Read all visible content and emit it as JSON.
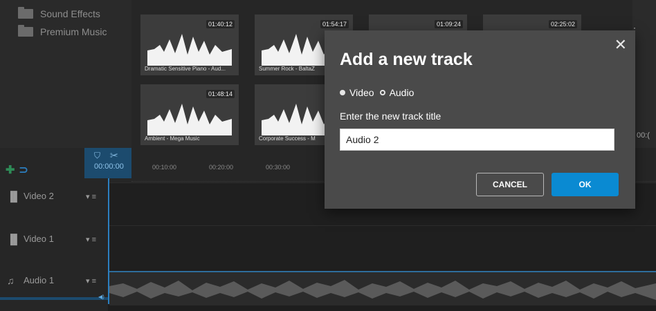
{
  "library": {
    "folders": [
      {
        "label": "Sound Effects"
      },
      {
        "label": "Premium Music"
      }
    ],
    "tiles": [
      {
        "duration": "01:40:12",
        "name": "Dramatic Sensitive Piano - Aud..."
      },
      {
        "duration": "01:54:17",
        "name": "Summer Rock - BaltaZ"
      },
      {
        "duration": "01:09:24",
        "name": ""
      },
      {
        "duration": "02:25:02",
        "name": ""
      },
      {
        "duration": "01:48:14",
        "name": "Ambient - Mega Music"
      },
      {
        "duration": "",
        "name": "Corporate Success - M"
      }
    ],
    "more_icon": "more-vertical-icon",
    "peek_text": "00:("
  },
  "timeline": {
    "playhead_time": "00:00:00",
    "ticks": [
      "00:10:00",
      "00:20:00",
      "00:30:00"
    ],
    "tracks": [
      {
        "name": "Video 2",
        "icon": "film-icon"
      },
      {
        "name": "Video 1",
        "icon": "film-icon"
      },
      {
        "name": "Audio 1",
        "icon": "music-note-icon"
      }
    ]
  },
  "modal": {
    "title": "Add a new track",
    "radio_video": "Video",
    "radio_audio": "Audio",
    "selected_type": "Audio",
    "field_label": "Enter the new track title",
    "field_value": "Audio 2",
    "cancel_label": "CANCEL",
    "ok_label": "OK"
  },
  "colors": {
    "accent": "#0a8ad2",
    "playhead": "#2b7fc1",
    "modal_bg": "#4a4a4a",
    "app_bg": "#1e1e1e"
  }
}
